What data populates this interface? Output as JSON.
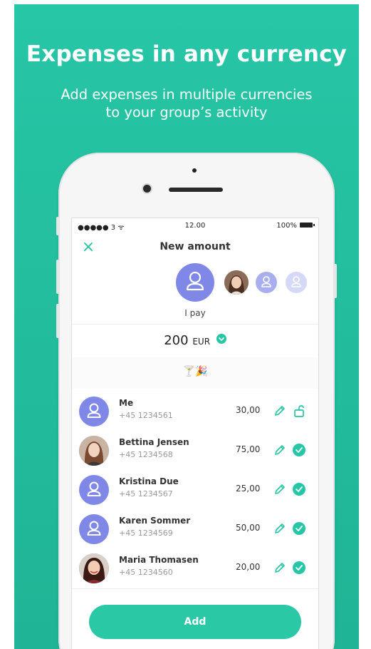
{
  "banner": {
    "headline": "Expenses in any currency",
    "subline_1": "Add expenses in multiple currencies",
    "subline_2": "to your group’s activity",
    "bg_color": "#27c6a6"
  },
  "status_bar": {
    "signal": "●●●●● 3 ᯤ",
    "time": "12.00",
    "battery": "100%"
  },
  "nav": {
    "close_icon": "×",
    "title": "New amount"
  },
  "payer": {
    "label": "I pay"
  },
  "amount": {
    "value": "200",
    "currency": "EUR"
  },
  "category": {
    "emoji": "🍸🎉"
  },
  "participants": [
    {
      "name": "Me",
      "phone": "+45 1234561",
      "amount": "30,00",
      "status": "unlocked",
      "avatar": "default"
    },
    {
      "name": "Bettina Jensen",
      "phone": "+45 1234568",
      "amount": "75,00",
      "status": "checked",
      "avatar": "photo"
    },
    {
      "name": "Kristina Due",
      "phone": "+45 1234567",
      "amount": "25,00",
      "status": "checked",
      "avatar": "default"
    },
    {
      "name": "Karen Sommer",
      "phone": "+45 1234569",
      "amount": "50,00",
      "status": "checked",
      "avatar": "default"
    },
    {
      "name": "Maria Thomasen",
      "phone": "+45 1234560",
      "amount": "20,00",
      "status": "checked",
      "avatar": "photo"
    }
  ],
  "actions": {
    "add_label": "Add"
  },
  "colors": {
    "accent": "#27c6a6",
    "avatar": "#7f88e6"
  }
}
